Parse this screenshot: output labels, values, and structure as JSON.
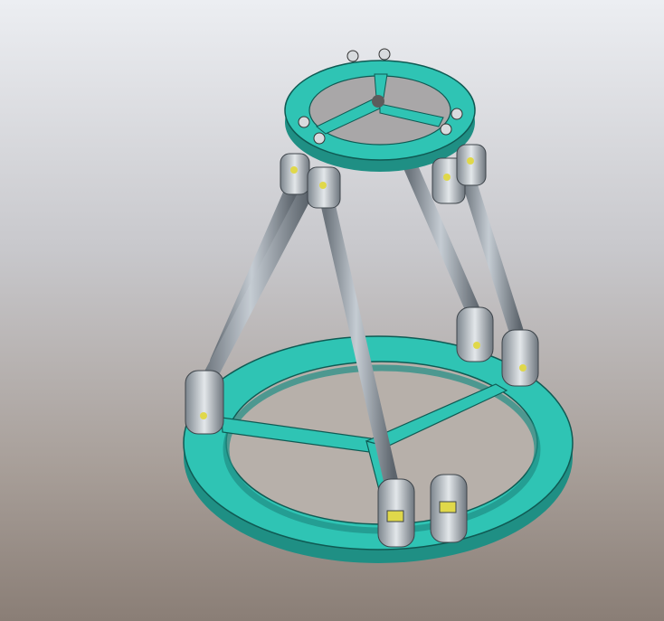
{
  "viewport": {
    "background_top": "#eceef2",
    "background_bottom": "#8a7e76"
  },
  "model": {
    "description_icon": "hexapod-stewart-platform-icon",
    "platform_color": "#2fc4b4",
    "platform_edge_color": "#1e8c80",
    "strut_color": "#9aa3ab",
    "joint_color": "#b7bec6",
    "joint_accent_color": "#e0d84a",
    "strut_count": 6
  }
}
